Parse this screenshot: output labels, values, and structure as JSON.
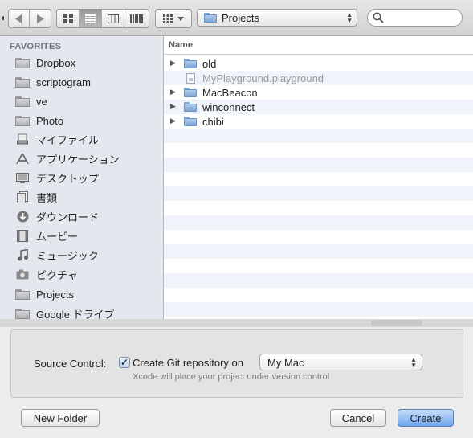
{
  "toolbar": {
    "location": "Projects",
    "search_placeholder": ""
  },
  "sidebar": {
    "heading": "FAVORITES",
    "items": [
      {
        "label": "Dropbox",
        "icon": "folder-icon"
      },
      {
        "label": "scriptogram",
        "icon": "folder-icon"
      },
      {
        "label": "ve",
        "icon": "folder-icon"
      },
      {
        "label": "Photo",
        "icon": "folder-icon"
      },
      {
        "label": "マイファイル",
        "icon": "all-my-files-icon"
      },
      {
        "label": "アプリケーション",
        "icon": "applications-icon"
      },
      {
        "label": "デスクトップ",
        "icon": "desktop-icon"
      },
      {
        "label": "書類",
        "icon": "documents-icon"
      },
      {
        "label": "ダウンロード",
        "icon": "downloads-icon"
      },
      {
        "label": "ムービー",
        "icon": "movies-icon"
      },
      {
        "label": "ミュージック",
        "icon": "music-icon"
      },
      {
        "label": "ピクチャ",
        "icon": "pictures-icon"
      },
      {
        "label": "Projects",
        "icon": "folder-icon"
      },
      {
        "label": "Google ドライブ",
        "icon": "folder-icon"
      }
    ]
  },
  "file_list": {
    "column_header": "Name",
    "rows": [
      {
        "name": "old",
        "kind": "folder",
        "dimmed": false
      },
      {
        "name": "MyPlayground.playground",
        "kind": "playground",
        "dimmed": true
      },
      {
        "name": "MacBeacon",
        "kind": "folder",
        "dimmed": false
      },
      {
        "name": "winconnect",
        "kind": "folder",
        "dimmed": false
      },
      {
        "name": "chibi",
        "kind": "folder",
        "dimmed": false
      }
    ]
  },
  "options": {
    "source_control_label": "Source Control:",
    "git_checkbox_label": "Create Git repository on",
    "git_checked": true,
    "location_value": "My Mac",
    "hint": "Xcode will place your project under version control"
  },
  "footer": {
    "new_folder": "New Folder",
    "cancel": "Cancel",
    "create": "Create"
  },
  "colors": {
    "default_button": "#6ea5ec",
    "sidebar_bg": "#e3e8ee",
    "folder_blue": "#7ea7d4"
  }
}
